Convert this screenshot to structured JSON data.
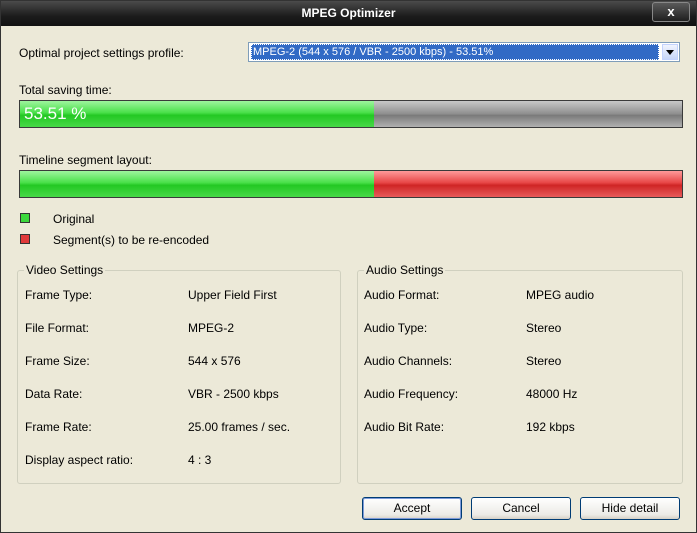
{
  "window": {
    "title": "MPEG Optimizer",
    "close_label": "x"
  },
  "profile": {
    "label": "Optimal project settings profile:",
    "selected": "MPEG-2 (544 x 576 / VBR - 2500 kbps) - 53.51%"
  },
  "saving": {
    "label": "Total saving time:",
    "value_text": "53.51 %",
    "fraction": 0.5351,
    "fill_color": "#3cd83c",
    "track_color": "#8e8e8e"
  },
  "timeline": {
    "label": "Timeline segment layout:",
    "original_fraction": 0.5351,
    "original_color": "#3cd83c",
    "reencode_color": "#e03a3a"
  },
  "legend": {
    "original": "Original",
    "reencode": "Segment(s) to be re-encoded"
  },
  "video": {
    "title": "Video Settings",
    "rows": [
      {
        "key": "Frame Type:",
        "value": "Upper Field First"
      },
      {
        "key": "File Format:",
        "value": "MPEG-2"
      },
      {
        "key": "Frame Size:",
        "value": "544 x 576"
      },
      {
        "key": "Data Rate:",
        "value": "VBR - 2500 kbps"
      },
      {
        "key": "Frame Rate:",
        "value": "25.00 frames / sec."
      },
      {
        "key": "Display aspect ratio:",
        "value": "4 : 3"
      }
    ]
  },
  "audio": {
    "title": "Audio Settings",
    "rows": [
      {
        "key": "Audio Format:",
        "value": "MPEG audio"
      },
      {
        "key": "Audio Type:",
        "value": "Stereo"
      },
      {
        "key": "Audio Channels:",
        "value": "Stereo"
      },
      {
        "key": "Audio Frequency:",
        "value": "48000 Hz"
      },
      {
        "key": "Audio Bit Rate:",
        "value": "192 kbps"
      }
    ]
  },
  "buttons": {
    "accept": "Accept",
    "cancel": "Cancel",
    "hide_detail": "Hide detail"
  }
}
